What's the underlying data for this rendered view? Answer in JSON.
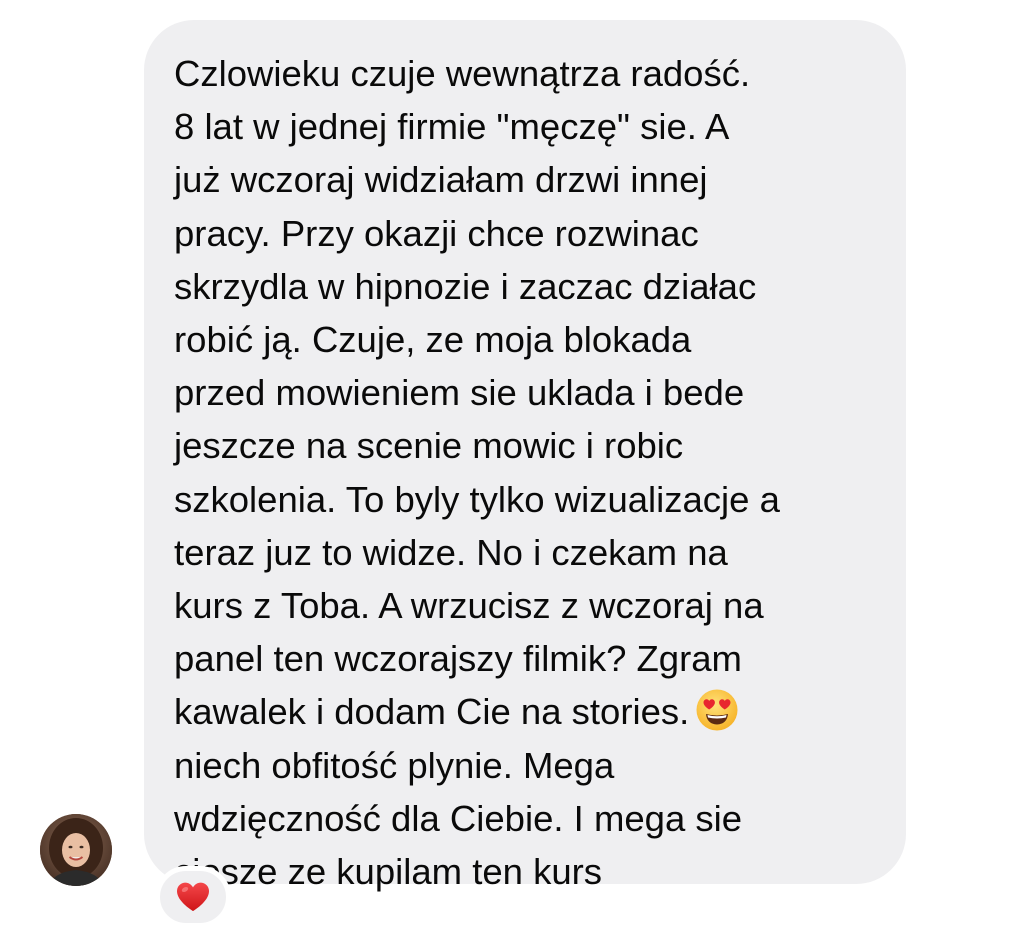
{
  "message": {
    "lines": [
      "Czlowieku czuje wewnątrza radość.",
      "8 lat w jednej firmie \"męczę\" sie. A",
      "już wczoraj widziałam drzwi innej",
      "pracy. Przy okazji chce rozwinac",
      "skrzydla w hipnozie i zaczac działac",
      "robić ją. Czuje, ze moja blokada",
      "przed mowieniem sie uklada i bede",
      "jeszcze na scenie mowic i robic",
      "szkolenia. To byly tylko wizualizacje a",
      "teraz juz to widze. No i czekam na",
      "kurs z Toba. A wrzucisz z wczoraj na",
      "panel ten wczorajszy filmik? Zgram",
      "kawalek i dodam Cie na stories.",
      "niech obfitość plynie. Mega",
      "wdzięczność dla Ciebie. I mega sie",
      "ciesze ze kupilam ten kurs"
    ],
    "inline_emoji": "heart-eyes-emoji"
  },
  "reaction": {
    "icon": "red-heart-icon",
    "color": "#e0201f"
  },
  "colors": {
    "bubble_background": "#efeff1",
    "text": "#0a0a0a",
    "page_background": "#ffffff"
  }
}
